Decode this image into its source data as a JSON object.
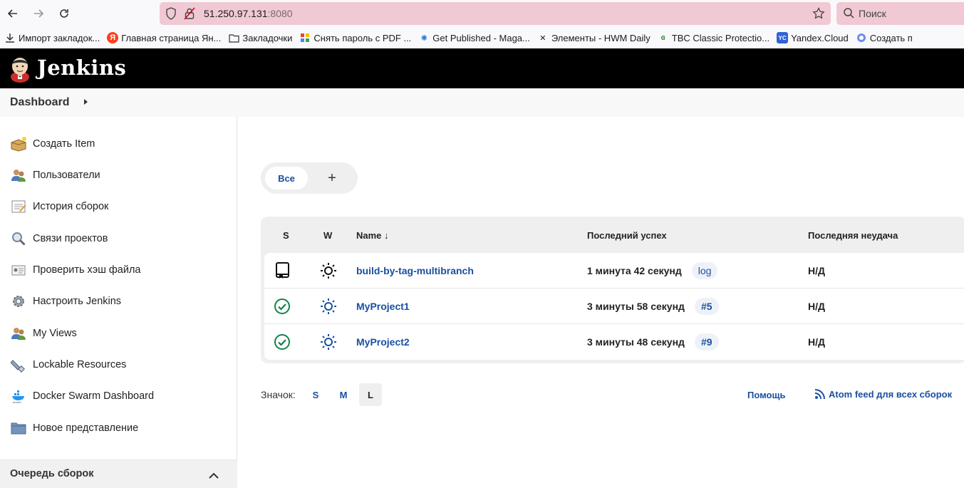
{
  "browser": {
    "url_host": "51.250.97.131",
    "url_port": ":8080",
    "search_placeholder": "Поиск",
    "bookmarks": [
      {
        "label": "Импорт закладок...",
        "icon": "import-icon"
      },
      {
        "label": "Главная страница Ян...",
        "icon": "yandex-icon"
      },
      {
        "label": "Закладочки",
        "icon": "folder-icon"
      },
      {
        "label": "Снять пароль с PDF ...",
        "icon": "pdf-site-icon"
      },
      {
        "label": "Get Published - Maga...",
        "icon": "starburst-icon"
      },
      {
        "label": "Элементы - HWM Daily",
        "icon": "tools-icon"
      },
      {
        "label": "TBC Classic Protectio...",
        "icon": "tbc-icon"
      },
      {
        "label": "Yandex.Cloud",
        "icon": "yandex-cloud-icon"
      },
      {
        "label": "Создать п",
        "icon": "globe-icon"
      }
    ]
  },
  "header": {
    "title": "Jenkins"
  },
  "breadcrumb": {
    "label": "Dashboard"
  },
  "sidebar": {
    "items": [
      {
        "label": "Создать Item",
        "icon": "new-item-icon"
      },
      {
        "label": "Пользователи",
        "icon": "users-icon"
      },
      {
        "label": "История сборок",
        "icon": "build-history-icon"
      },
      {
        "label": "Связи проектов",
        "icon": "search-icon"
      },
      {
        "label": "Проверить хэш файла",
        "icon": "fingerprint-icon"
      },
      {
        "label": "Настроить Jenkins",
        "icon": "gear-icon"
      },
      {
        "label": "My Views",
        "icon": "users-icon"
      },
      {
        "label": "Lockable Resources",
        "icon": "usb-icon"
      },
      {
        "label": "Docker Swarm Dashboard",
        "icon": "docker-icon"
      },
      {
        "label": "Новое представление",
        "icon": "folder-icon"
      }
    ],
    "queue_label": "Очередь сборок"
  },
  "views": {
    "tab_all": "Все",
    "tab_add": "+"
  },
  "table": {
    "headers": {
      "s": "S",
      "w": "W",
      "name": "Name",
      "name_sort": "↓",
      "last_success": "Последний успех",
      "last_failure": "Последняя неудача"
    },
    "rows": [
      {
        "status": "multibranch",
        "name": "build-by-tag-multibranch",
        "last_success": "1 минута 42 секунд",
        "success_link": "log",
        "last_failure": "Н/Д"
      },
      {
        "status": "success",
        "name": "MyProject1",
        "last_success": "3 минуты 58 секунд",
        "success_link": "#5",
        "last_failure": "Н/Д"
      },
      {
        "status": "success",
        "name": "MyProject2",
        "last_success": "3 минуты 48 секунд",
        "success_link": "#9",
        "last_failure": "Н/Д"
      }
    ]
  },
  "footer": {
    "icon_label": "Значок:",
    "sizes": [
      "S",
      "M",
      "L"
    ],
    "active_size": "L",
    "help": "Помощь",
    "atom": "Atom feed для всех сборок"
  },
  "colors": {
    "jenkins_header": "#000000",
    "link": "#1a4fa0",
    "success": "#138347",
    "url_bar": "#f0c9d4"
  }
}
